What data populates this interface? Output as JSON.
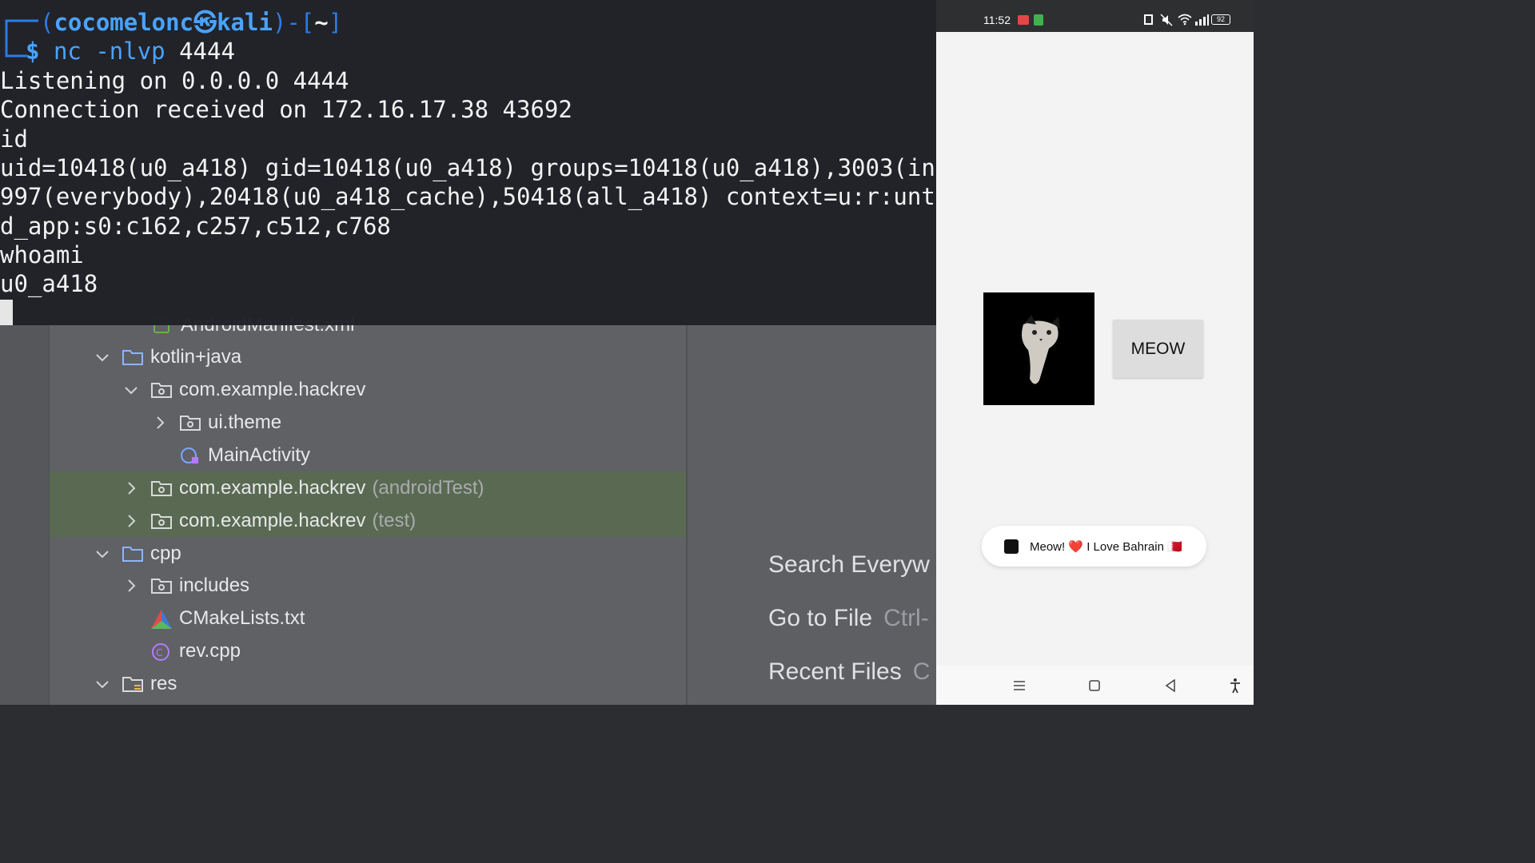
{
  "terminal": {
    "prompt": {
      "user_host": "cocomelonc㉿kali",
      "path": "~",
      "dollar": "$",
      "command": "nc -nlvp 4444"
    },
    "lines": [
      "Listening on 0.0.0.0 4444",
      "Connection received on 172.16.17.38 43692",
      "id",
      "uid=10418(u0_a418) gid=10418(u0_a418) groups=10418(u0_a418),3003(in",
      "997(everybody),20418(u0_a418_cache),50418(all_a418) context=u:r:unt",
      "d_app:s0:c162,c257,c512,c768",
      "whoami",
      "u0_a418"
    ]
  },
  "project_tree": {
    "partial_top": "AndroidManifest.xml",
    "items": [
      {
        "label": "kotlin+java",
        "suffix": "",
        "expanded": true,
        "icon": "folder-icon"
      },
      {
        "label": "com.example.hackrev",
        "suffix": "",
        "expanded": true,
        "icon": "package-icon"
      },
      {
        "label": "ui.theme",
        "suffix": "",
        "expanded": false,
        "icon": "package-icon"
      },
      {
        "label": "MainActivity",
        "suffix": "",
        "icon": "kotlin-class-icon"
      },
      {
        "label": "com.example.hackrev",
        "suffix": "(androidTest)",
        "expanded": false,
        "icon": "package-icon"
      },
      {
        "label": "com.example.hackrev",
        "suffix": "(test)",
        "expanded": false,
        "icon": "package-icon"
      },
      {
        "label": "cpp",
        "suffix": "",
        "expanded": true,
        "icon": "folder-icon"
      },
      {
        "label": "includes",
        "suffix": "",
        "expanded": false,
        "icon": "package-icon"
      },
      {
        "label": "CMakeLists.txt",
        "suffix": "",
        "icon": "cmake-icon"
      },
      {
        "label": "rev.cpp",
        "suffix": "",
        "icon": "cpp-file-icon"
      },
      {
        "label": "res",
        "suffix": "",
        "expanded": true,
        "icon": "res-folder-icon"
      }
    ]
  },
  "quick_actions": {
    "search": {
      "label": "Search Everyw",
      "shortcut": ""
    },
    "goto_file": {
      "label": "Go to File",
      "shortcut": "Ctrl-"
    },
    "recent_files": {
      "label": "Recent Files",
      "shortcut": "C"
    }
  },
  "phone": {
    "status": {
      "time": "11:52",
      "battery": "92"
    },
    "button_label": "MEOW",
    "toast": {
      "text": "Meow! ❤️ I Love Bahrain 🇧🇭"
    }
  },
  "colors": {
    "terminal_bg": "#1e2026",
    "prompt_accent": "#4aa3ff",
    "tree_selection": "#5a6a52",
    "phone_bg": "#f3f3f3"
  }
}
